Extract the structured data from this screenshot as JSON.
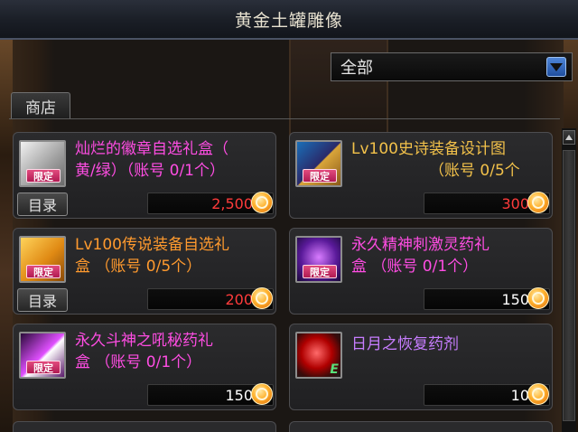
{
  "window": {
    "title": "黄金土罐雕像"
  },
  "filter": {
    "selected": "全部"
  },
  "tabs": [
    {
      "label": "商店"
    }
  ],
  "items": [
    {
      "name_line1": "灿烂的徽章自选礼盒（",
      "name_line2": "黄/绿）（账号 0/1个）",
      "badge": "限定",
      "catalog_label": "目录",
      "price": "2,500",
      "name_color": "#ff4de3",
      "price_color": "#ff3b3b",
      "icon": "badge-box-icon"
    },
    {
      "name_line1": "Lv100史诗装备设计图",
      "name_line2": "（账号 0/5个",
      "badge": "限定",
      "price": "300",
      "name_color": "#f2c14a",
      "price_color": "#ff3b3b",
      "icon": "epic-blueprint-icon"
    },
    {
      "name_line1": "Lv100传说装备自选礼",
      "name_line2": "盒  （账号 0/5个）",
      "badge": "限定",
      "catalog_label": "目录",
      "price": "200",
      "name_color": "#ff9a2e",
      "price_color": "#ff3b3b",
      "icon": "legend-box-icon"
    },
    {
      "name_line1": "永久精神刺激灵药礼",
      "name_line2": "盒  （账号 0/1个）",
      "badge": "限定",
      "price": "150",
      "name_color": "#ff4de3",
      "price_color": "#ffffff",
      "icon": "spirit-potion-icon"
    },
    {
      "name_line1": "永久斗神之吼秘药礼",
      "name_line2": "盒  （账号 0/1个）",
      "badge": "限定",
      "price": "150",
      "name_color": "#ff4de3",
      "price_color": "#ffffff",
      "icon": "war-god-potion-icon"
    },
    {
      "name_line1": "日月之恢复药剂",
      "name_line2": "",
      "badge": "",
      "price": "10",
      "name_color": "#c77dff",
      "price_color": "#ffffff",
      "icon": "sun-moon-potion-icon",
      "mark": "E"
    }
  ]
}
